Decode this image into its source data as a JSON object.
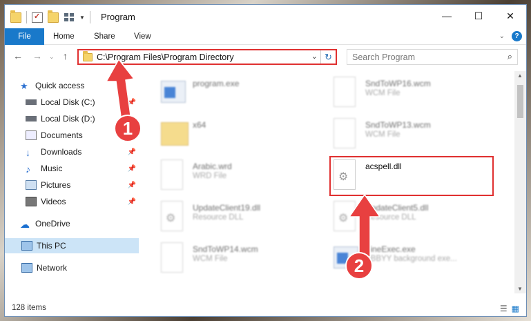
{
  "window": {
    "title": "Program",
    "controls": {
      "minimize": "—",
      "maximize": "☐",
      "close": "✕"
    }
  },
  "ribbon": {
    "tabs": [
      "File",
      "Home",
      "Share",
      "View"
    ]
  },
  "address": {
    "path": "C:\\Program Files\\Program Directory",
    "search_placeholder": "Search Program"
  },
  "sidebar": {
    "items": [
      {
        "label": "Quick access",
        "icon": "star-icon"
      },
      {
        "label": "Local Disk (C:)",
        "icon": "drive-icon",
        "pinned": true
      },
      {
        "label": "Local Disk (D:)",
        "icon": "drive-icon",
        "pinned": true
      },
      {
        "label": "Documents",
        "icon": "documents-icon",
        "pinned": true
      },
      {
        "label": "Downloads",
        "icon": "download-icon",
        "pinned": true
      },
      {
        "label": "Music",
        "icon": "music-icon",
        "pinned": true
      },
      {
        "label": "Pictures",
        "icon": "pictures-icon",
        "pinned": true
      },
      {
        "label": "Videos",
        "icon": "videos-icon",
        "pinned": true
      },
      {
        "label": "OneDrive",
        "icon": "cloud-icon"
      },
      {
        "label": "This PC",
        "icon": "computer-icon",
        "selected": true
      },
      {
        "label": "Network",
        "icon": "network-icon"
      }
    ]
  },
  "files": [
    {
      "name": "program.exe",
      "type": "",
      "kind": "exe"
    },
    {
      "name": "SndToWP16.wcm",
      "type": "WCM File",
      "kind": "doc"
    },
    {
      "name": "x64",
      "type": "",
      "kind": "folder"
    },
    {
      "name": "SndToWP13.wcm",
      "type": "WCM File",
      "kind": "doc"
    },
    {
      "name": "Arabic.wrd",
      "type": "WRD File",
      "kind": "doc"
    },
    {
      "name": "acspell.dll",
      "type": "",
      "kind": "dll"
    },
    {
      "name": "UpdateClient19.dll",
      "type": "Resource DLL",
      "kind": "dll"
    },
    {
      "name": "UpdateClient5.dll",
      "type": "Resource DLL",
      "kind": "dll"
    },
    {
      "name": "SndToWP14.wcm",
      "type": "WCM File",
      "kind": "doc"
    },
    {
      "name": "FineExec.exe",
      "type": "ABBYY background exe...",
      "kind": "exe"
    }
  ],
  "status": {
    "count": "128 items"
  },
  "annotations": {
    "badge1": "1",
    "badge2": "2"
  },
  "colors": {
    "accent": "#1979ca",
    "highlight": "#e03030",
    "selected": "#cce4f7"
  }
}
